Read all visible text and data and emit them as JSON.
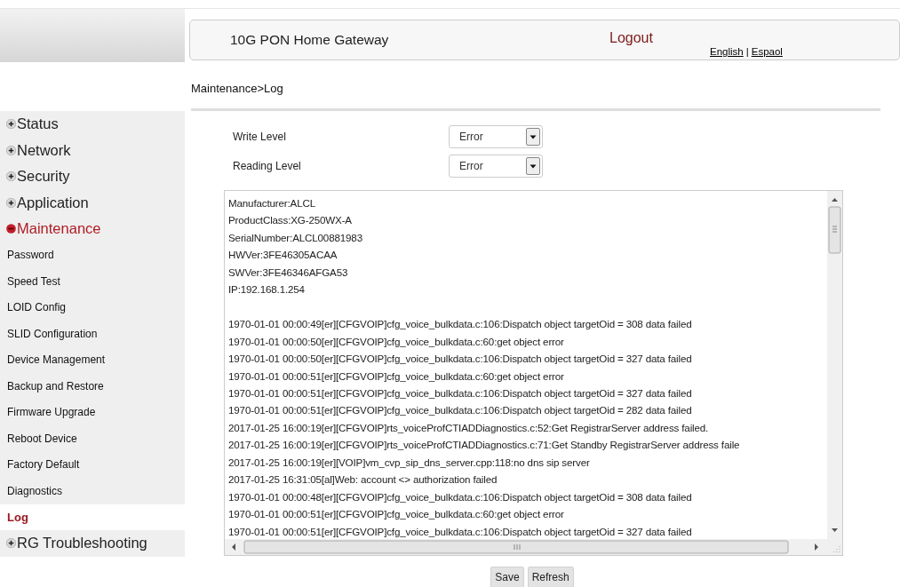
{
  "header": {
    "title": "10G PON Home Gateway",
    "logout": "Logout",
    "languages": [
      "English",
      "Espaol"
    ],
    "separator": "|"
  },
  "breadcrumb": "Maintenance>Log",
  "sidebar": {
    "items": [
      {
        "label": "Status",
        "expanded": false
      },
      {
        "label": "Network",
        "expanded": false
      },
      {
        "label": "Security",
        "expanded": false
      },
      {
        "label": "Application",
        "expanded": false
      },
      {
        "label": "Maintenance",
        "expanded": true,
        "children": [
          {
            "label": "Password",
            "selected": false
          },
          {
            "label": "Speed Test",
            "selected": false
          },
          {
            "label": "LOID Config",
            "selected": false
          },
          {
            "label": "SLID Configuration",
            "selected": false
          },
          {
            "label": "Device Management",
            "selected": false
          },
          {
            "label": "Backup and Restore",
            "selected": false
          },
          {
            "label": "Firmware Upgrade",
            "selected": false
          },
          {
            "label": "Reboot Device",
            "selected": false
          },
          {
            "label": "Factory Default",
            "selected": false
          },
          {
            "label": "Diagnostics",
            "selected": false
          },
          {
            "label": "Log",
            "selected": true
          }
        ]
      },
      {
        "label": "RG Troubleshooting",
        "expanded": false
      }
    ]
  },
  "settings": [
    {
      "label": "Write Level",
      "value": "Error"
    },
    {
      "label": "Reading Level",
      "value": "Error"
    }
  ],
  "log": {
    "device_info": [
      "Manufacturer:ALCL",
      "ProductClass:XG-250WX-A",
      "SerialNumber:ALCL00881983",
      "HWVer:3FE46305ACAA",
      "SWVer:3FE46346AFGA53",
      "IP:192.168.1.254"
    ],
    "entries": [
      "1970-01-01 00:00:49[er][CFGVOIP]cfg_voice_bulkdata.c:106:Dispatch object targetOid = 308 data failed",
      "1970-01-01 00:00:50[er][CFGVOIP]cfg_voice_bulkdata.c:60:get object error",
      "1970-01-01 00:00:50[er][CFGVOIP]cfg_voice_bulkdata.c:106:Dispatch object targetOid = 327 data failed",
      "1970-01-01 00:00:51[er][CFGVOIP]cfg_voice_bulkdata.c:60:get object error",
      "1970-01-01 00:00:51[er][CFGVOIP]cfg_voice_bulkdata.c:106:Dispatch object targetOid = 327 data failed",
      "1970-01-01 00:00:51[er][CFGVOIP]cfg_voice_bulkdata.c:106:Dispatch object targetOid = 282 data failed",
      "2017-01-25 16:00:19[er][CFGVOIP]rts_voiceProfCTIADDiagnostics.c:52:Get RegistrarServer address failed.",
      "2017-01-25 16:00:19[er][CFGVOIP]rts_voiceProfCTIADDiagnostics.c:71:Get Standby RegistrarServer address faile",
      "2017-01-25 16:00:19[er][VOIP]vm_cvp_sip_dns_server.cpp:118:no dns sip server",
      "2017-01-25 16:31:05[al]Web: account <> authorization failed",
      "1970-01-01 00:00:48[er][CFGVOIP]cfg_voice_bulkdata.c:106:Dispatch object targetOid = 308 data failed",
      "1970-01-01 00:00:51[er][CFGVOIP]cfg_voice_bulkdata.c:60:get object error",
      "1970-01-01 00:00:51[er][CFGVOIP]cfg_voice_bulkdata.c:106:Dispatch object targetOid = 327 data failed"
    ]
  },
  "buttons": [
    "Save",
    "Refresh"
  ]
}
